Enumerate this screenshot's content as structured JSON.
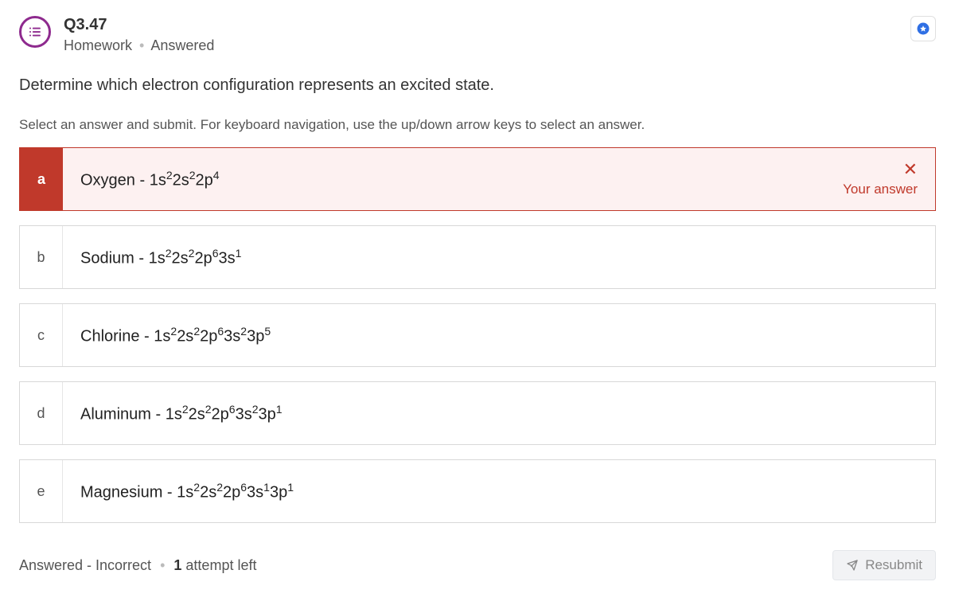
{
  "header": {
    "question_number": "Q3.47",
    "category": "Homework",
    "status": "Answered"
  },
  "prompt": "Determine which electron configuration represents an excited state.",
  "instruction": "Select an answer and submit. For keyboard navigation, use the up/down arrow keys to select an answer.",
  "options": [
    {
      "letter": "a",
      "element": "Oxygen",
      "config": [
        [
          "1s",
          "2"
        ],
        [
          "2s",
          "2"
        ],
        [
          "2p",
          "4"
        ]
      ],
      "selected": true,
      "correct": false
    },
    {
      "letter": "b",
      "element": "Sodium",
      "config": [
        [
          "1s",
          "2"
        ],
        [
          "2s",
          "2"
        ],
        [
          "2p",
          "6"
        ],
        [
          "3s",
          "1"
        ]
      ],
      "selected": false
    },
    {
      "letter": "c",
      "element": "Chlorine",
      "config": [
        [
          "1s",
          "2"
        ],
        [
          "2s",
          "2"
        ],
        [
          "2p",
          "6"
        ],
        [
          "3s",
          "2"
        ],
        [
          "3p",
          "5"
        ]
      ],
      "selected": false
    },
    {
      "letter": "d",
      "element": "Aluminum",
      "config": [
        [
          "1s",
          "2"
        ],
        [
          "2s",
          "2"
        ],
        [
          "2p",
          "6"
        ],
        [
          "3s",
          "2"
        ],
        [
          "3p",
          "1"
        ]
      ],
      "selected": false
    },
    {
      "letter": "e",
      "element": "Magnesium",
      "config": [
        [
          "1s",
          "2"
        ],
        [
          "2s",
          "2"
        ],
        [
          "2p",
          "6"
        ],
        [
          "3s",
          "1"
        ],
        [
          "3p",
          "1"
        ]
      ],
      "selected": false
    }
  ],
  "your_answer_label": "Your answer",
  "footer": {
    "status": "Answered - Incorrect",
    "attempts_count": "1",
    "attempts_suffix": " attempt left",
    "resubmit_label": "Resubmit"
  },
  "colors": {
    "accent_purple": "#8e2a8e",
    "error_red": "#c0392b",
    "star_blue": "#2f6fe4"
  }
}
